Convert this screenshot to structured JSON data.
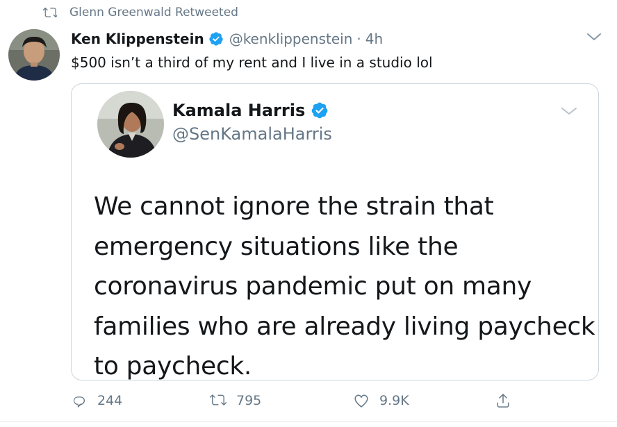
{
  "retweet": {
    "label": "Glenn Greenwald Retweeted",
    "icon": "retweet-icon"
  },
  "tweet": {
    "author_name": "Ken Klippenstein",
    "handle": "@kenklippenstein",
    "separator": "·",
    "time": "4h",
    "verified": true,
    "text": "$500 isn’t a third of my rent and I live in a studio lol"
  },
  "quoted_tweet": {
    "author_name": "Kamala Harris",
    "handle": "@SenKamalaHarris",
    "verified": true,
    "body_lines": [
      "We cannot ignore the strain that",
      "emergency situations like the",
      "coronavirus pandemic put on many",
      "families who are already living paycheck",
      "to paycheck."
    ]
  },
  "actions": {
    "replies": "244",
    "retweets": "795",
    "likes": "9.9K"
  },
  "colors": {
    "text": "#14171a",
    "secondary": "#657786",
    "verified_blue": "#1da1f2",
    "border": "#ccd6dd"
  }
}
